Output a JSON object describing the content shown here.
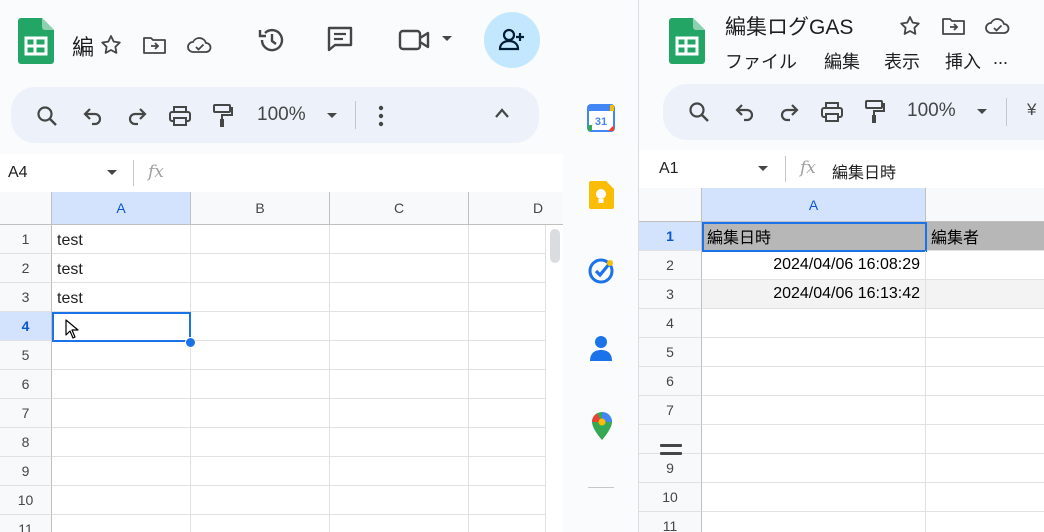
{
  "left": {
    "doc_title_fragment": "編",
    "toolbar": {
      "zoom": "100%"
    },
    "name_box": "A4",
    "formula_value": "",
    "columns": [
      "A",
      "B",
      "C",
      "D"
    ],
    "rows": [
      "1",
      "2",
      "3",
      "4",
      "5",
      "6",
      "7",
      "8",
      "9",
      "10",
      "11"
    ],
    "cells": {
      "A1": "test",
      "A2": "test",
      "A3": "test"
    }
  },
  "right": {
    "doc_title": "編集ログGAS",
    "menu": {
      "file": "ファイル",
      "edit": "編集",
      "view": "表示",
      "insert": "挿入",
      "more": "..."
    },
    "toolbar": {
      "zoom": "100%",
      "currency": "¥"
    },
    "name_box": "A1",
    "formula_value": "編集日時",
    "columns": [
      "A"
    ],
    "rows": [
      "1",
      "2",
      "3",
      "4",
      "5",
      "6",
      "7",
      "8",
      "9",
      "10",
      "11"
    ],
    "cells": {
      "A1": "編集日時",
      "B1": "編集者",
      "A2": "2024/04/06 16:08:29",
      "A3": "2024/04/06 16:13:42"
    }
  },
  "side_panel": {
    "calendar_day": "31"
  },
  "colors": {
    "accent": "#1a73e8",
    "share": "#c2e7ff",
    "header_gray": "#b7b7b7",
    "sheets_green": "#0f9d58"
  }
}
